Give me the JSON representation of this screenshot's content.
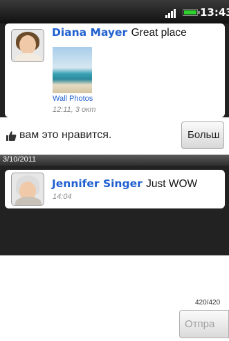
{
  "status_bar": {
    "time": "13:43",
    "signal_icon": "signal-bars-icon",
    "battery_icon": "battery-icon",
    "battery_color": "#2fd02f"
  },
  "posts": [
    {
      "author": "Diana Mayer",
      "message": "Great place",
      "album": "Wall Photos",
      "time": "12:11, 3 окт"
    },
    {
      "author": "Jennifer Singer",
      "message": "Just WOW",
      "time": "14:04"
    }
  ],
  "like_bar": {
    "icon": "thumbs-up-icon",
    "text": "вам это нравится.",
    "more_button": "Больш"
  },
  "date_divider": "3/10/2011",
  "compose": {
    "counter": "420/420",
    "send_button": "Отпра"
  },
  "colors": {
    "name_link": "#1f5fcf",
    "timestamp": "#8a8a8a"
  }
}
